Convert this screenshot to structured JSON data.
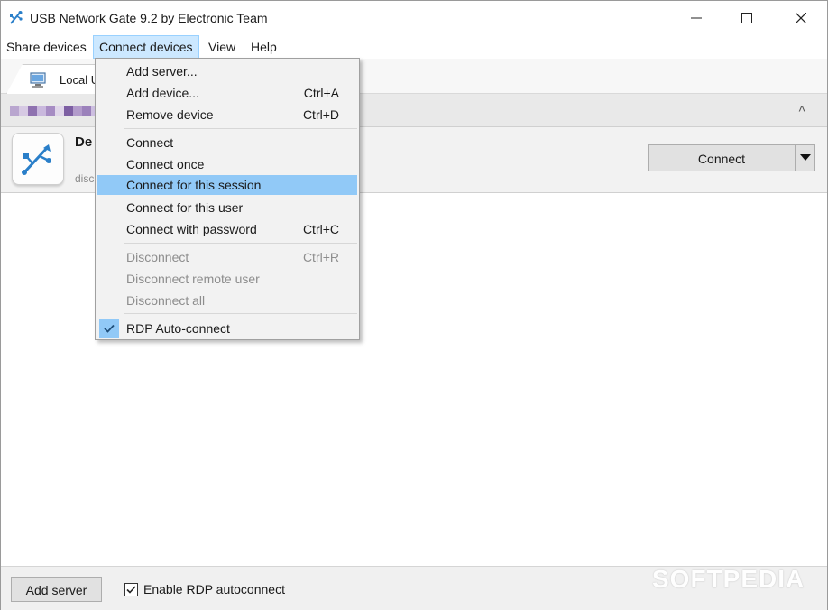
{
  "window": {
    "title": "USB Network Gate 9.2 by Electronic Team",
    "controls": {
      "minimize": "—",
      "maximize": "☐",
      "close": "✕"
    }
  },
  "menubar": {
    "items": [
      "Share devices",
      "Connect devices",
      "View",
      "Help"
    ],
    "active": "Connect devices"
  },
  "tabs": [
    {
      "label": "Local U",
      "icon": "monitor-icon"
    }
  ],
  "group": {
    "collapse_glyph": "˄"
  },
  "device": {
    "name": "De",
    "status": "disc",
    "connect_label": "Connect",
    "icon": "usb-icon"
  },
  "connect_menu": {
    "items": [
      {
        "label": "Add server...",
        "shortcut": "",
        "enabled": true
      },
      {
        "label": "Add device...",
        "shortcut": "Ctrl+A",
        "enabled": true
      },
      {
        "label": "Remove device",
        "shortcut": "Ctrl+D",
        "enabled": true
      },
      {
        "label": "Connect",
        "shortcut": "",
        "enabled": true
      },
      {
        "label": "Connect once",
        "shortcut": "",
        "enabled": true
      },
      {
        "label": "Connect for this session",
        "shortcut": "",
        "enabled": true,
        "highlighted": true
      },
      {
        "label": "Connect for this user",
        "shortcut": "",
        "enabled": true
      },
      {
        "label": "Connect with password",
        "shortcut": "Ctrl+C",
        "enabled": true
      },
      {
        "label": "Disconnect",
        "shortcut": "Ctrl+R",
        "enabled": false
      },
      {
        "label": "Disconnect remote user",
        "shortcut": "",
        "enabled": false
      },
      {
        "label": "Disconnect all",
        "shortcut": "",
        "enabled": false
      },
      {
        "label": "RDP Auto-connect",
        "shortcut": "",
        "enabled": true,
        "checked": true
      }
    ]
  },
  "bottombar": {
    "add_server_label": "Add server",
    "rdp_checkbox_label": "Enable RDP autoconnect",
    "rdp_checked": true,
    "watermark": "SOFTPEDIA"
  },
  "colors": {
    "menu_highlight": "#91c9f7",
    "menubar_active": "#cce8ff",
    "usb_blue": "#2a7fc9"
  }
}
